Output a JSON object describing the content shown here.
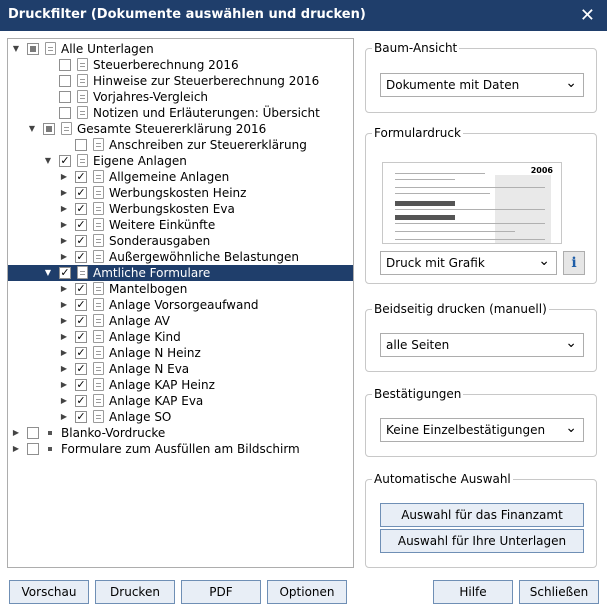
{
  "window": {
    "title": "Druckfilter (Dokumente auswählen und drucken)",
    "close_glyph": "✕"
  },
  "tree": [
    {
      "label": "Alle Unterlagen",
      "level": 0,
      "expander": "expanded",
      "check": "partial",
      "icon": "doc",
      "selected": false
    },
    {
      "label": "Steuerberechnung 2016",
      "level": 2,
      "expander": "none",
      "check": "unchecked",
      "icon": "doc",
      "selected": false
    },
    {
      "label": "Hinweise zur Steuerberechnung 2016",
      "level": 2,
      "expander": "none",
      "check": "unchecked",
      "icon": "doc",
      "selected": false
    },
    {
      "label": "Vorjahres-Vergleich",
      "level": 2,
      "expander": "none",
      "check": "unchecked",
      "icon": "doc",
      "selected": false
    },
    {
      "label": "Notizen und Erläuterungen: Übersicht",
      "level": 2,
      "expander": "none",
      "check": "unchecked",
      "icon": "doc",
      "selected": false
    },
    {
      "label": "Gesamte Steuererklärung 2016",
      "level": 1,
      "expander": "expanded",
      "check": "partial",
      "icon": "doc",
      "selected": false
    },
    {
      "label": "Anschreiben zur Steuererklärung",
      "level": 3,
      "expander": "none",
      "check": "unchecked",
      "icon": "doc",
      "selected": false
    },
    {
      "label": "Eigene Anlagen",
      "level": 2,
      "expander": "expanded",
      "check": "checked",
      "icon": "doc",
      "selected": false
    },
    {
      "label": "Allgemeine Anlagen",
      "level": 3,
      "expander": "collapsed",
      "check": "checked",
      "icon": "doc",
      "selected": false
    },
    {
      "label": "Werbungskosten Heinz",
      "level": 3,
      "expander": "collapsed",
      "check": "checked",
      "icon": "doc",
      "selected": false
    },
    {
      "label": "Werbungskosten Eva",
      "level": 3,
      "expander": "collapsed",
      "check": "checked",
      "icon": "doc",
      "selected": false
    },
    {
      "label": "Weitere Einkünfte",
      "level": 3,
      "expander": "collapsed",
      "check": "checked",
      "icon": "doc",
      "selected": false
    },
    {
      "label": "Sonderausgaben",
      "level": 3,
      "expander": "collapsed",
      "check": "checked",
      "icon": "doc",
      "selected": false
    },
    {
      "label": "Außergewöhnliche Belastungen",
      "level": 3,
      "expander": "collapsed",
      "check": "checked",
      "icon": "doc",
      "selected": false
    },
    {
      "label": "Amtliche Formulare",
      "level": 2,
      "expander": "expanded",
      "check": "checked",
      "icon": "doc",
      "selected": true
    },
    {
      "label": "Mantelbogen",
      "level": 3,
      "expander": "collapsed",
      "check": "checked",
      "icon": "doc",
      "selected": false
    },
    {
      "label": "Anlage Vorsorgeaufwand",
      "level": 3,
      "expander": "collapsed",
      "check": "checked",
      "icon": "doc",
      "selected": false
    },
    {
      "label": "Anlage AV",
      "level": 3,
      "expander": "collapsed",
      "check": "checked",
      "icon": "doc",
      "selected": false
    },
    {
      "label": "Anlage Kind",
      "level": 3,
      "expander": "collapsed",
      "check": "checked",
      "icon": "doc",
      "selected": false
    },
    {
      "label": "Anlage N Heinz",
      "level": 3,
      "expander": "collapsed",
      "check": "checked",
      "icon": "doc",
      "selected": false
    },
    {
      "label": "Anlage N Eva",
      "level": 3,
      "expander": "collapsed",
      "check": "checked",
      "icon": "doc",
      "selected": false
    },
    {
      "label": "Anlage KAP Heinz",
      "level": 3,
      "expander": "collapsed",
      "check": "checked",
      "icon": "doc",
      "selected": false
    },
    {
      "label": "Anlage KAP Eva",
      "level": 3,
      "expander": "collapsed",
      "check": "checked",
      "icon": "doc",
      "selected": false
    },
    {
      "label": "Anlage SO",
      "level": 3,
      "expander": "collapsed",
      "check": "checked",
      "icon": "doc",
      "selected": false
    },
    {
      "label": "Blanko-Vordrucke",
      "level": 0,
      "expander": "collapsed",
      "check": "unchecked",
      "icon": "square",
      "selected": false
    },
    {
      "label": "Formulare zum Ausfüllen am Bildschirm",
      "level": 0,
      "expander": "collapsed",
      "check": "unchecked",
      "icon": "square",
      "selected": false
    }
  ],
  "baum_ansicht": {
    "label": "Baum-Ansicht",
    "value": "Dokumente mit Daten"
  },
  "formulardruck": {
    "label": "Formulardruck",
    "preview_year": "2006",
    "value": "Druck mit Grafik",
    "info_glyph": "i"
  },
  "beidseitig": {
    "label": "Beidseitig drucken (manuell)",
    "value": "alle Seiten"
  },
  "bestaetigungen": {
    "label": "Bestätigungen",
    "value": "Keine Einzelbestätigungen"
  },
  "auto_auswahl": {
    "label": "Automatische Auswahl",
    "btn_finanzamt": "Auswahl für das Finanzamt",
    "btn_unterlagen": "Auswahl für Ihre Unterlagen"
  },
  "footer": {
    "vorschau": "Vorschau",
    "drucken": "Drucken",
    "pdf": "PDF",
    "optionen": "Optionen",
    "hilfe": "Hilfe",
    "schliessen": "Schließen"
  },
  "colors": {
    "titlebar": "#1f3e6b",
    "selection": "#1f3e6b",
    "button_border": "#6f8fb5"
  }
}
